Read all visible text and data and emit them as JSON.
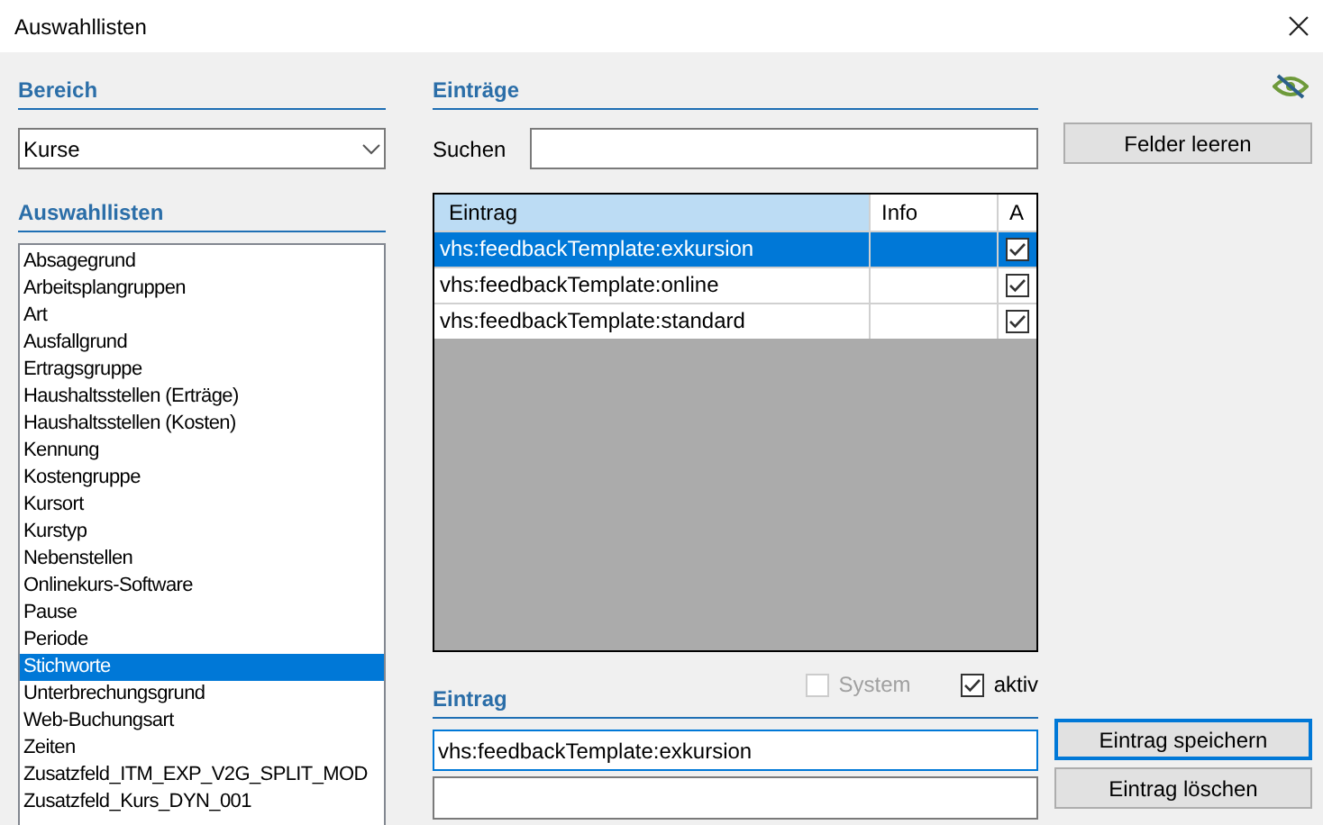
{
  "window": {
    "title": "Auswahllisten"
  },
  "bereich": {
    "heading": "Bereich",
    "value": "Kurse"
  },
  "lists": {
    "heading": "Auswahllisten",
    "items": [
      {
        "label": "Absagegrund",
        "selected": false
      },
      {
        "label": "Arbeitsplangruppen",
        "selected": false
      },
      {
        "label": "Art",
        "selected": false
      },
      {
        "label": "Ausfallgrund",
        "selected": false
      },
      {
        "label": "Ertragsgruppe",
        "selected": false
      },
      {
        "label": "Haushaltsstellen (Erträge)",
        "selected": false
      },
      {
        "label": "Haushaltsstellen (Kosten)",
        "selected": false
      },
      {
        "label": "Kennung",
        "selected": false
      },
      {
        "label": "Kostengruppe",
        "selected": false
      },
      {
        "label": "Kursort",
        "selected": false
      },
      {
        "label": "Kurstyp",
        "selected": false
      },
      {
        "label": "Nebenstellen",
        "selected": false
      },
      {
        "label": "Onlinekurs-Software",
        "selected": false
      },
      {
        "label": "Pause",
        "selected": false
      },
      {
        "label": "Periode",
        "selected": false
      },
      {
        "label": "Stichworte",
        "selected": true
      },
      {
        "label": "Unterbrechungsgrund",
        "selected": false
      },
      {
        "label": "Web-Buchungsart",
        "selected": false
      },
      {
        "label": "Zeiten",
        "selected": false
      },
      {
        "label": "Zusatzfeld_ITM_EXP_V2G_SPLIT_MOD",
        "selected": false
      },
      {
        "label": "Zusatzfeld_Kurs_DYN_001",
        "selected": false
      }
    ]
  },
  "entries": {
    "heading": "Einträge",
    "search_label": "Suchen",
    "columns": [
      {
        "label": "Eintrag",
        "highlighted": true
      },
      {
        "label": "Info",
        "highlighted": false
      },
      {
        "label": "A",
        "highlighted": false
      }
    ],
    "rows": [
      {
        "entry": "vhs:feedbackTemplate:exkursion",
        "active": true,
        "selected": true
      },
      {
        "entry": "vhs:feedbackTemplate:online",
        "active": true,
        "selected": false
      },
      {
        "entry": "vhs:feedbackTemplate:standard",
        "active": true,
        "selected": false
      }
    ]
  },
  "clear_button": "Felder leeren",
  "entry": {
    "heading": "Eintrag",
    "system": {
      "label": "System",
      "checked": false,
      "disabled": true
    },
    "aktiv": {
      "label": "aktiv",
      "checked": true,
      "disabled": false
    },
    "value": "vhs:feedbackTemplate:exkursion"
  },
  "buttons": {
    "save": "Eintrag speichern",
    "delete": "Eintrag löschen"
  }
}
